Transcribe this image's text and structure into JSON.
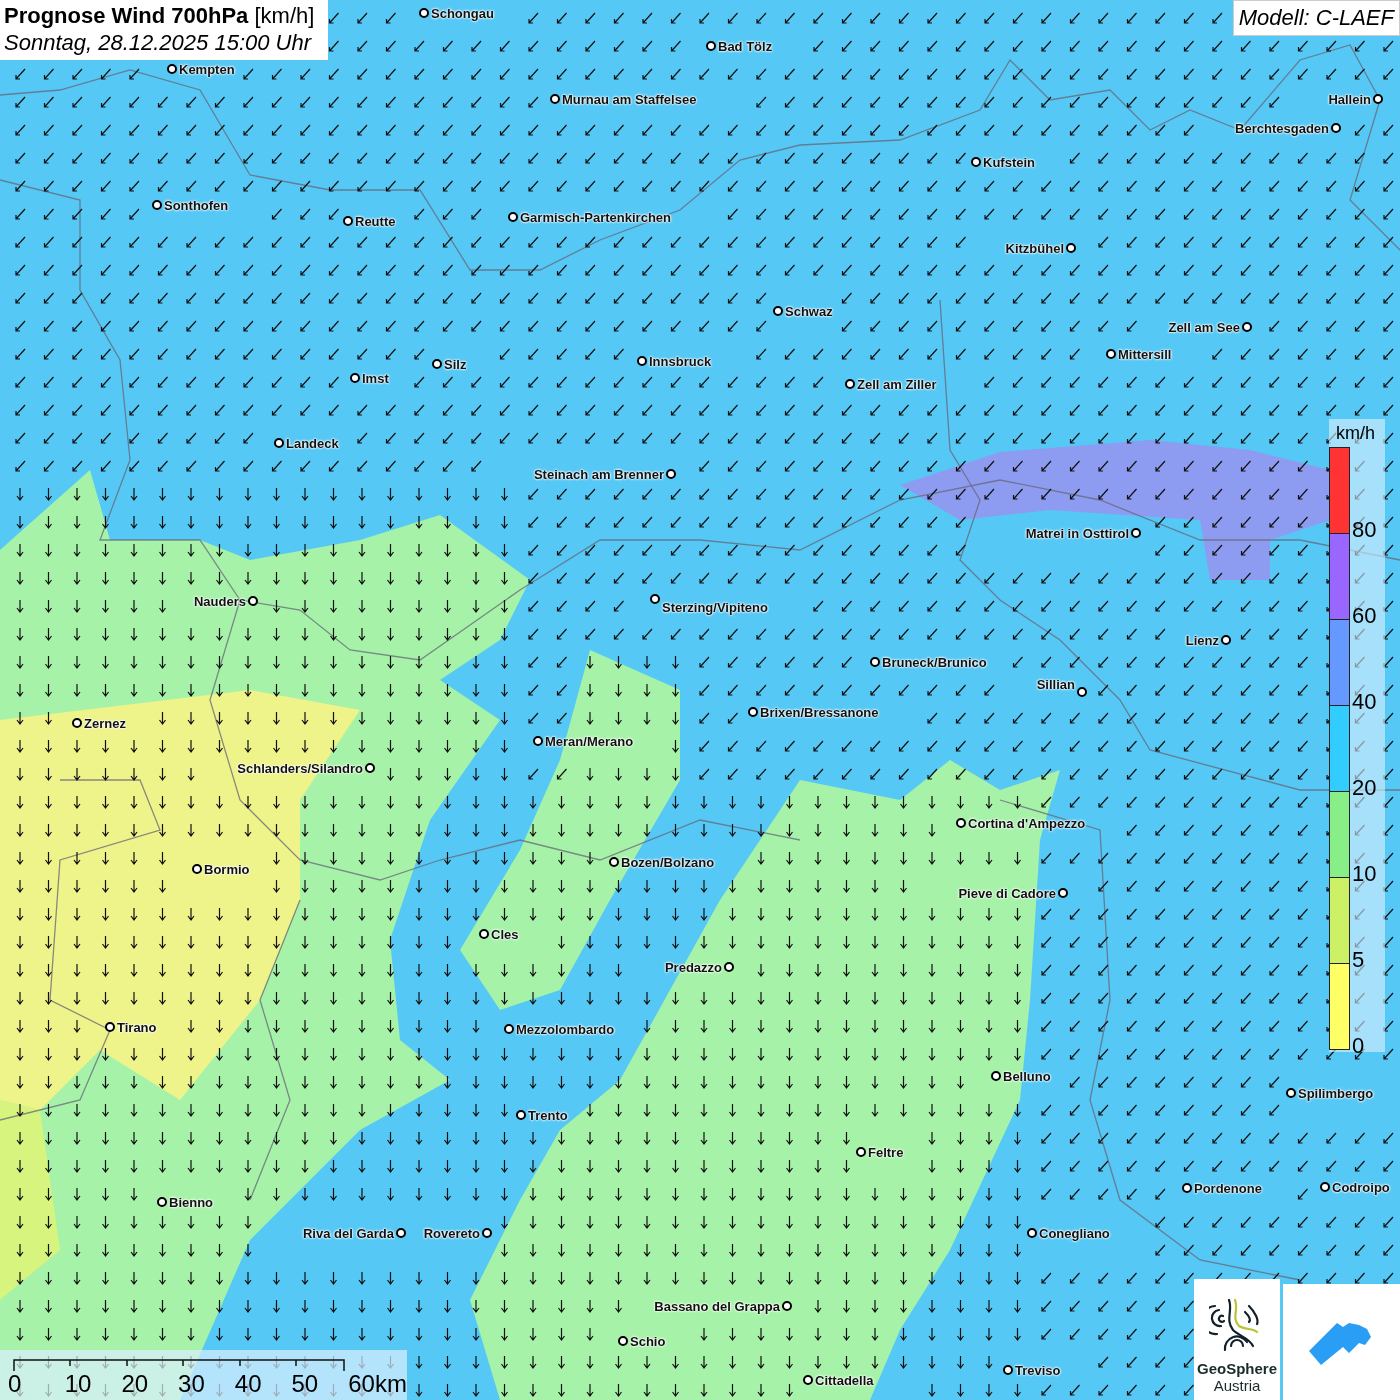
{
  "header": {
    "title": "Prognose Wind 700hPa",
    "unit": "[km/h]",
    "subtitle": "Sonntag, 28.12.2025 15:00 Uhr"
  },
  "model": "Modell: C-LAEF",
  "cities": [
    {
      "name": "Schongau"
    },
    {
      "name": "Bad Tölz"
    },
    {
      "name": "Kempten"
    },
    {
      "name": "Murnau am Staffelsee"
    },
    {
      "name": "Hallein"
    },
    {
      "name": "Berchtesgaden"
    },
    {
      "name": "Kufstein"
    },
    {
      "name": "Sonthofen"
    },
    {
      "name": "Reutte"
    },
    {
      "name": "Garmisch-Partenkirchen"
    },
    {
      "name": "Kitzbühel"
    },
    {
      "name": "Schwaz"
    },
    {
      "name": "Zell am See"
    },
    {
      "name": "Innsbruck"
    },
    {
      "name": "Silz"
    },
    {
      "name": "Mittersill"
    },
    {
      "name": "Imst"
    },
    {
      "name": "Zell am Ziller"
    },
    {
      "name": "Landeck"
    },
    {
      "name": "Steinach am Brenner"
    },
    {
      "name": "Matrei in Osttirol"
    },
    {
      "name": "Nauders"
    },
    {
      "name": "Sterzing/Vipiteno"
    },
    {
      "name": "Lienz"
    },
    {
      "name": "Bruneck/Brunico"
    },
    {
      "name": "Sillian"
    },
    {
      "name": "Brixen/Bressanone"
    },
    {
      "name": "Zernez"
    },
    {
      "name": "Meran/Merano"
    },
    {
      "name": "Schlanders/Silandro"
    },
    {
      "name": "Cortina d'Ampezzo"
    },
    {
      "name": "Bozen/Bolzano"
    },
    {
      "name": "Bormio"
    },
    {
      "name": "Pieve di Cadore"
    },
    {
      "name": "Cles"
    },
    {
      "name": "Predazzo"
    },
    {
      "name": "Tirano"
    },
    {
      "name": "Mezzolombardo"
    },
    {
      "name": "Belluno"
    },
    {
      "name": "Spilimbergo"
    },
    {
      "name": "Trento"
    },
    {
      "name": "Feltre"
    },
    {
      "name": "Pordenone"
    },
    {
      "name": "Codroipo"
    },
    {
      "name": "Bienno"
    },
    {
      "name": "Riva del Garda"
    },
    {
      "name": "Rovereto"
    },
    {
      "name": "Conegliano"
    },
    {
      "name": "Bassano del Grappa"
    },
    {
      "name": "Schio"
    },
    {
      "name": "Treviso"
    },
    {
      "name": "Cittadella"
    }
  ],
  "legend": {
    "unit": "km/h",
    "classes": [
      {
        "label": "80",
        "color": "#ff3333"
      },
      {
        "label": "60",
        "color": "#9966ff"
      },
      {
        "label": "40",
        "color": "#6699ff"
      },
      {
        "label": "20",
        "color": "#33ccff"
      },
      {
        "label": "10",
        "color": "#88ee88"
      },
      {
        "label": "5",
        "color": "#ccf066"
      },
      {
        "label": "0",
        "color": "#ffff66"
      }
    ]
  },
  "scale": {
    "ticks": [
      "0",
      "10",
      "20",
      "30",
      "40",
      "50",
      "60km"
    ]
  },
  "logo": {
    "line_1": "GeoSphere",
    "line_2": "Austria"
  }
}
